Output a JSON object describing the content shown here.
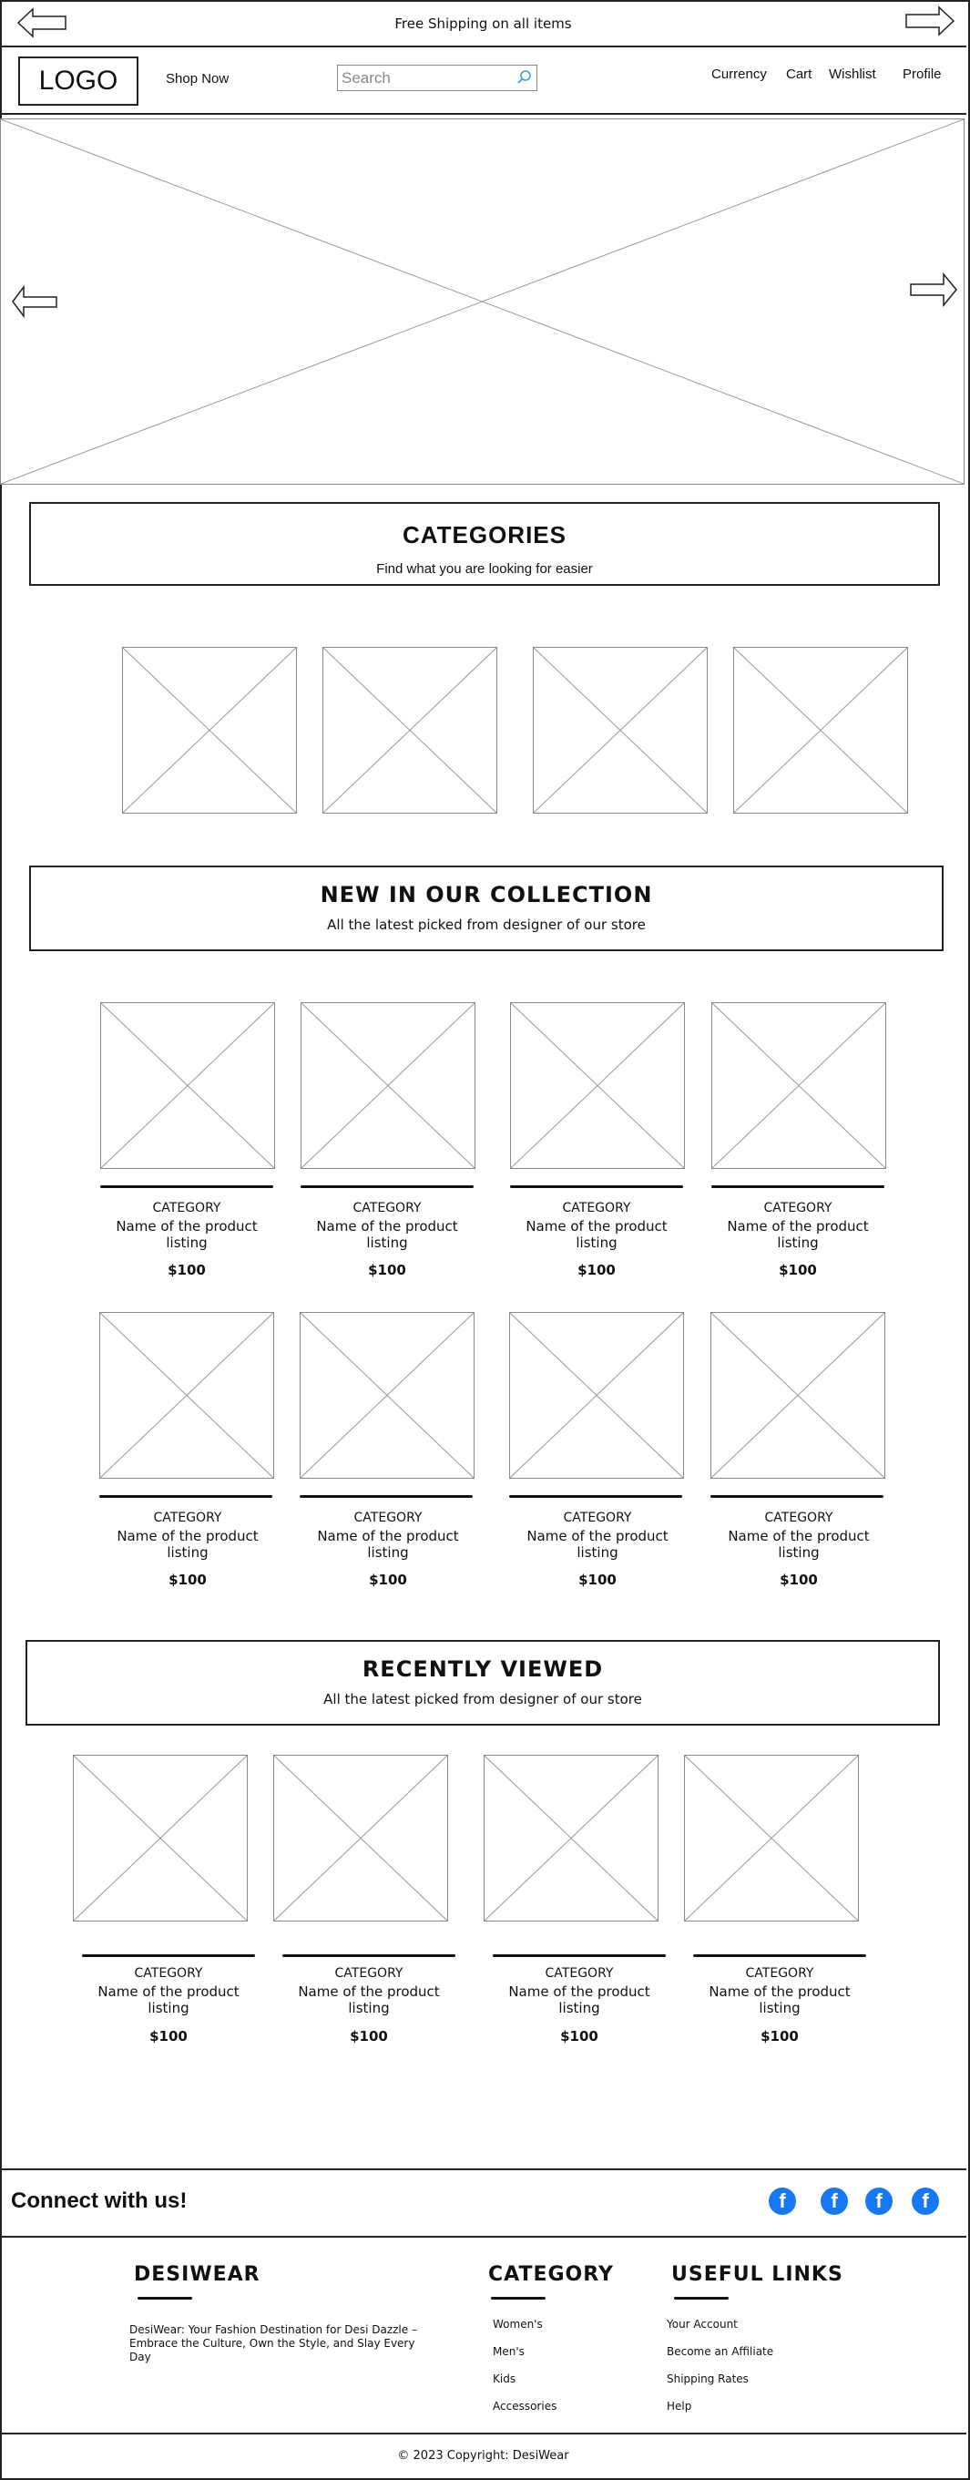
{
  "topbar": {
    "announcement": "Free Shipping on all items",
    "prev_icon": "arrow-left-icon",
    "next_icon": "arrow-right-icon"
  },
  "header": {
    "logo": "LOGO",
    "shop_now": "Shop Now",
    "search_placeholder": "Search",
    "search_icon": "search-icon",
    "nav": {
      "currency": "Currency",
      "cart": "Cart",
      "wishlist": "Wishlist",
      "profile": "Profile"
    }
  },
  "hero": {
    "prev_icon": "arrow-left-icon",
    "next_icon": "arrow-right-icon"
  },
  "categories_section": {
    "title": "CATEGORIES",
    "subtitle": "Find what you are looking for easier"
  },
  "new_collection": {
    "title": "NEW IN OUR COLLECTION",
    "subtitle": "All the latest picked from designer of our store",
    "products": [
      {
        "category": "CATEGORY",
        "name": "Name of the product listing",
        "price": "$100"
      },
      {
        "category": "CATEGORY",
        "name": "Name of the product listing",
        "price": "$100"
      },
      {
        "category": "CATEGORY",
        "name": "Name of the product listing",
        "price": "$100"
      },
      {
        "category": "CATEGORY",
        "name": "Name of the product listing",
        "price": "$100"
      },
      {
        "category": "CATEGORY",
        "name": "Name of the product listing",
        "price": "$100"
      },
      {
        "category": "CATEGORY",
        "name": "Name of the product listing",
        "price": "$100"
      },
      {
        "category": "CATEGORY",
        "name": "Name of the product listing",
        "price": "$100"
      },
      {
        "category": "CATEGORY",
        "name": "Name of the product listing",
        "price": "$100"
      }
    ]
  },
  "recently_viewed": {
    "title": "RECENTLY VIEWED",
    "subtitle": "All the latest picked from designer of our store",
    "products": [
      {
        "category": "CATEGORY",
        "name": "Name of the product listing",
        "price": "$100"
      },
      {
        "category": "CATEGORY",
        "name": "Name of the product listing",
        "price": "$100"
      },
      {
        "category": "CATEGORY",
        "name": "Name of the product listing",
        "price": "$100"
      },
      {
        "category": "CATEGORY",
        "name": "Name of the product listing",
        "price": "$100"
      }
    ]
  },
  "connect": {
    "title": "Connect with us!",
    "social_icon": "facebook-icon"
  },
  "footer": {
    "brand": {
      "title": "DESIWEAR",
      "about": "DesiWear: Your Fashion Destination for Desi Dazzle – Embrace the Culture, Own the Style, and Slay Every Day"
    },
    "category": {
      "title": "CATEGORY",
      "links": [
        "Women's",
        "Men's",
        "Kids",
        "Accessories"
      ]
    },
    "useful_links": {
      "title": "USEFUL LINKS",
      "links": [
        "Your Account",
        "Become an Affiliate",
        "Shipping Rates",
        "Help"
      ]
    },
    "copyright": "© 2023 Copyright: DesiWear"
  }
}
